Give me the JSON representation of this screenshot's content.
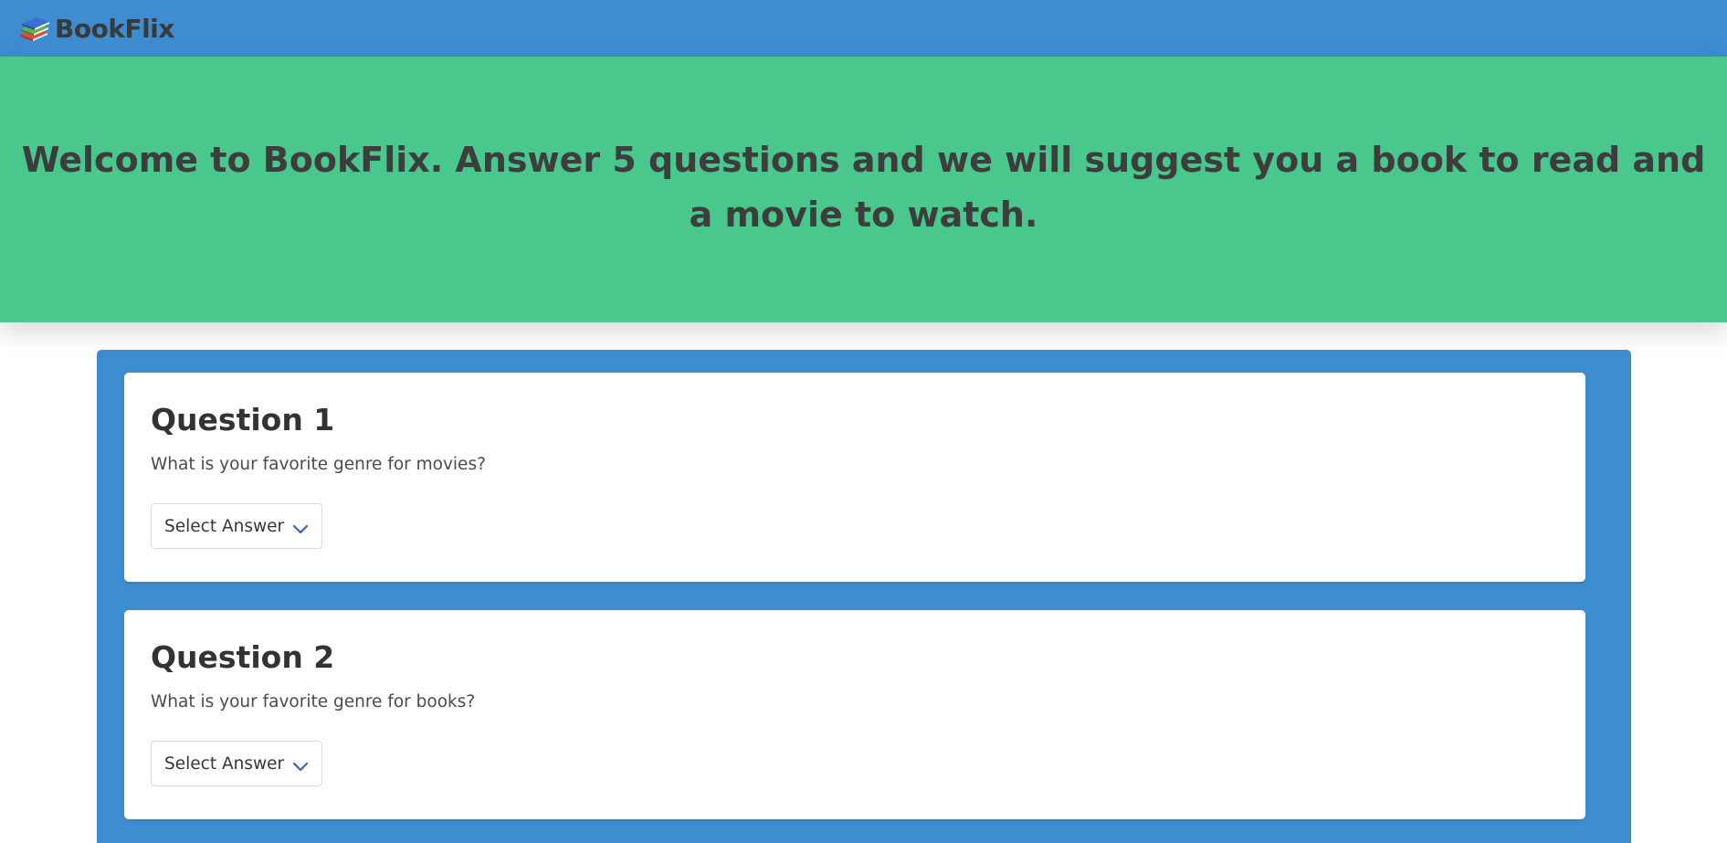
{
  "navbar": {
    "brand_name": "BookFlix",
    "brand_icon": "books-stack-icon"
  },
  "hero": {
    "title": "Welcome to BookFlix. Answer 5 questions and we will suggest you a book to read and a movie to watch."
  },
  "questions": [
    {
      "title": "Question 1",
      "text": "What is your favorite genre for movies?",
      "select_label": "Select Answer"
    },
    {
      "title": "Question 2",
      "text": "What is your favorite genre for books?",
      "select_label": "Select Answer"
    }
  ],
  "colors": {
    "navbar": "#3e8dd0",
    "hero": "#4ac78c",
    "panel": "#3e8dd0",
    "chevron": "#3b5fc4"
  }
}
